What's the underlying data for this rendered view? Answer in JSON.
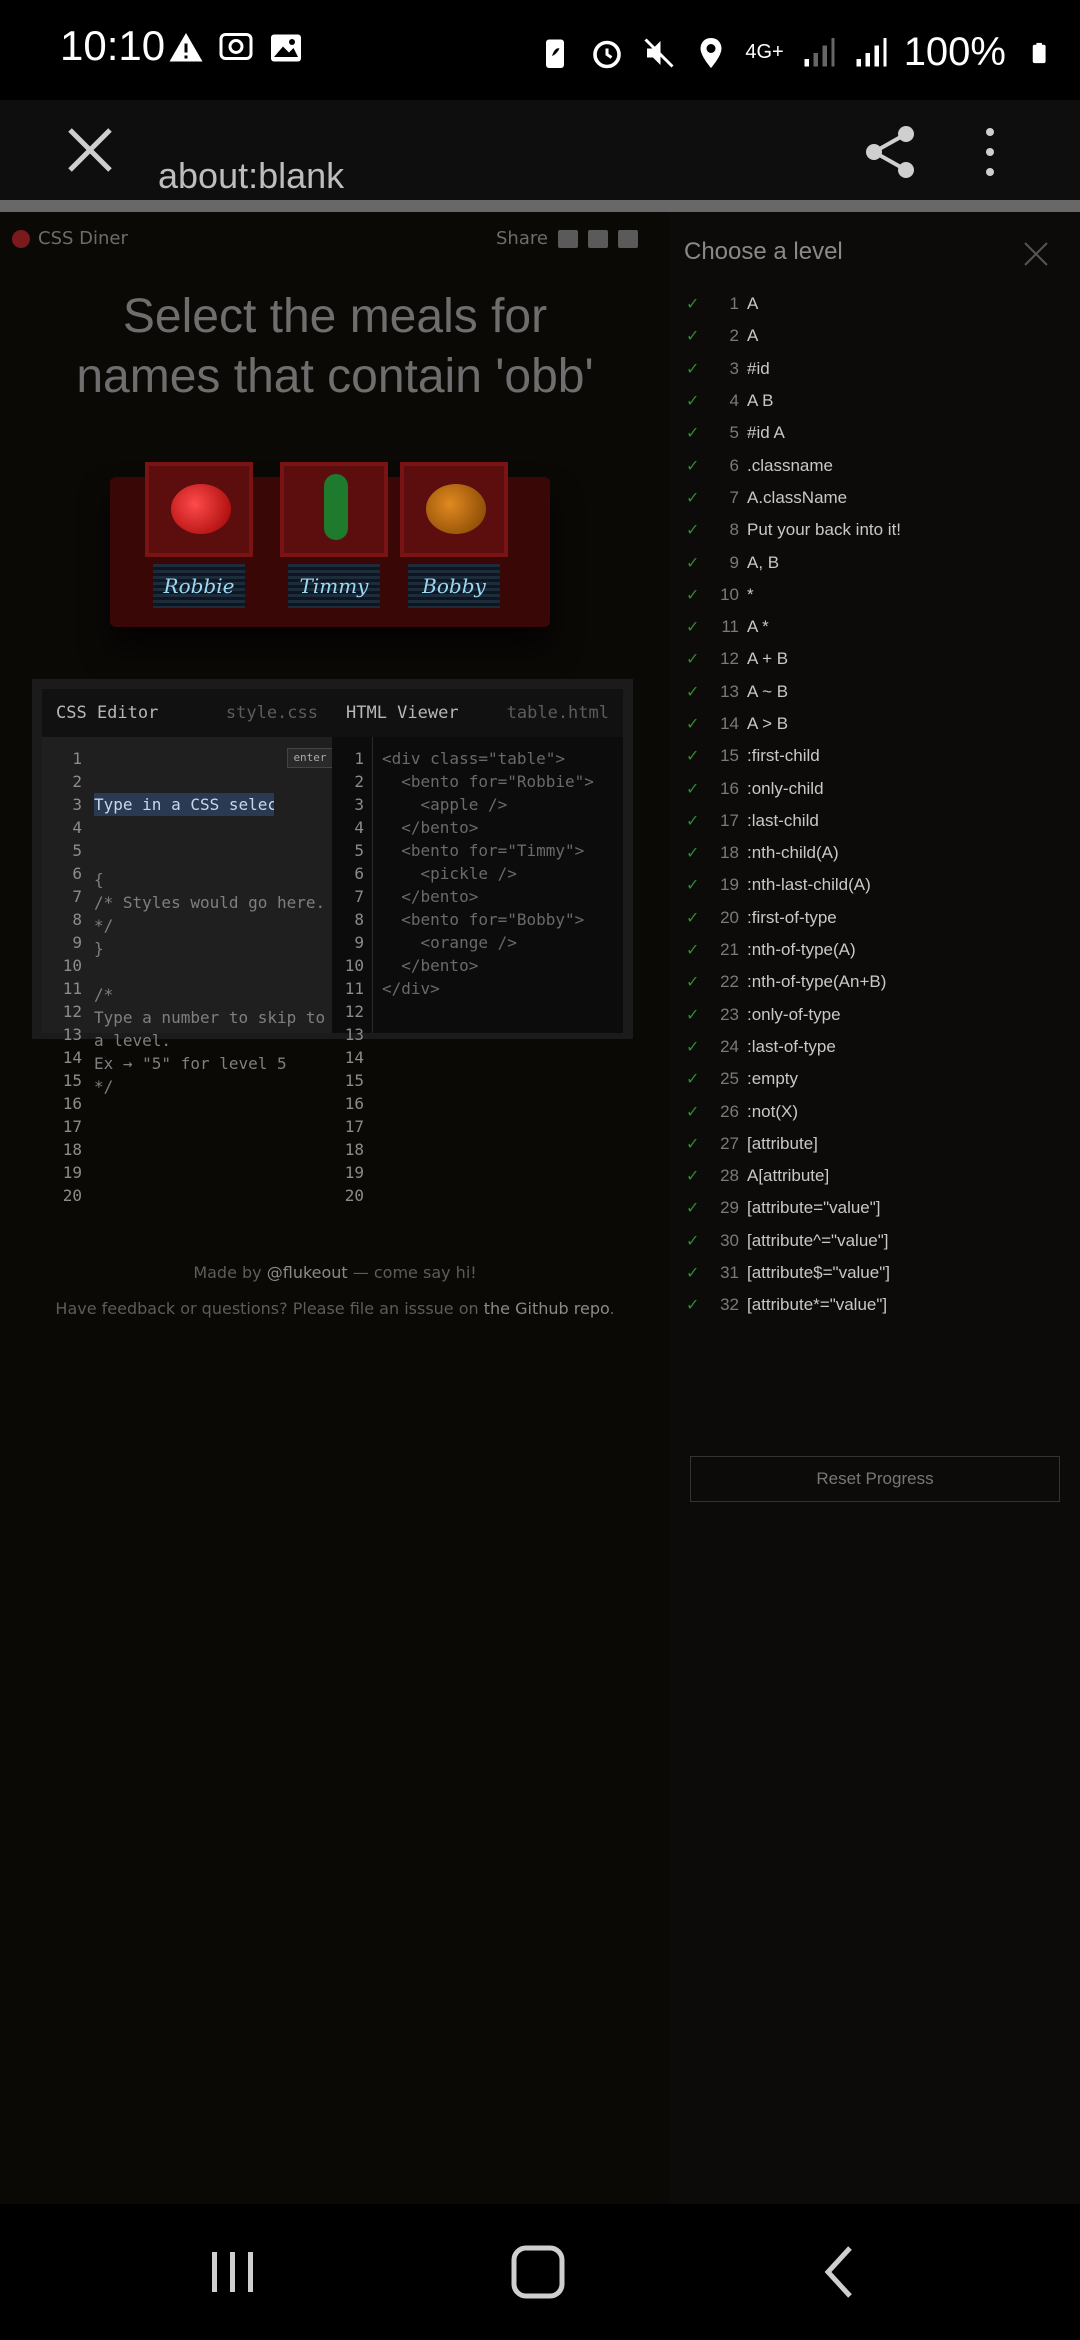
{
  "status_bar": {
    "time": "10:10",
    "battery": "100%",
    "network": "4G+"
  },
  "toolbar": {
    "url": "about:blank"
  },
  "page": {
    "brand": "CSS Diner",
    "share_label": "Share",
    "instruction_line1": "Select the meals for",
    "instruction_line2": "names that contain 'obb'",
    "bentos": [
      {
        "name": "Robbie",
        "food": "apple"
      },
      {
        "name": "Timmy",
        "food": "pickle"
      },
      {
        "name": "Bobby",
        "food": "orange"
      }
    ],
    "css_editor": {
      "title": "CSS Editor",
      "file": "style.css",
      "enter_label": "enter",
      "input_placeholder": "Type in a CSS selector",
      "lines": [
        "{",
        "/* Styles would go here.",
        "*/",
        "}",
        "",
        "/*",
        "Type a number to skip to",
        "a level.",
        "Ex → \"5\" for level 5",
        "*/"
      ]
    },
    "html_viewer": {
      "title": "HTML Viewer",
      "file": "table.html",
      "lines": [
        "<div class=\"table\">",
        "  <bento for=\"Robbie\">",
        "    <apple />",
        "  </bento>",
        "  <bento for=\"Timmy\">",
        "    <pickle />",
        "  </bento>",
        "  <bento for=\"Bobby\">",
        "    <orange />",
        "  </bento>",
        "</div>"
      ]
    },
    "line_numbers": [
      "1",
      "2",
      "3",
      "4",
      "5",
      "6",
      "7",
      "8",
      "9",
      "10",
      "11",
      "12",
      "13",
      "14",
      "15",
      "16",
      "17",
      "18",
      "19",
      "20"
    ],
    "footer_made_by": "Made by",
    "footer_author": "@flukeout",
    "footer_say_hi": "— come say hi!",
    "footer_feedback": "Have feedback or questions? Please file an isssue on",
    "footer_repo": "the Github repo",
    "footer_period": "."
  },
  "levels_panel": {
    "title": "Choose a level",
    "reset_label": "Reset Progress",
    "levels": [
      {
        "num": "1",
        "name": "A"
      },
      {
        "num": "2",
        "name": "A"
      },
      {
        "num": "3",
        "name": "#id"
      },
      {
        "num": "4",
        "name": "A B"
      },
      {
        "num": "5",
        "name": "#id A"
      },
      {
        "num": "6",
        "name": ".classname"
      },
      {
        "num": "7",
        "name": "A.className"
      },
      {
        "num": "8",
        "name": "Put your back into it!"
      },
      {
        "num": "9",
        "name": "A, B"
      },
      {
        "num": "10",
        "name": "*"
      },
      {
        "num": "11",
        "name": "A *"
      },
      {
        "num": "12",
        "name": "A + B"
      },
      {
        "num": "13",
        "name": "A ~ B"
      },
      {
        "num": "14",
        "name": "A > B"
      },
      {
        "num": "15",
        "name": ":first-child"
      },
      {
        "num": "16",
        "name": ":only-child"
      },
      {
        "num": "17",
        "name": ":last-child"
      },
      {
        "num": "18",
        "name": ":nth-child(A)"
      },
      {
        "num": "19",
        "name": ":nth-last-child(A)"
      },
      {
        "num": "20",
        "name": ":first-of-type"
      },
      {
        "num": "21",
        "name": ":nth-of-type(A)"
      },
      {
        "num": "22",
        "name": ":nth-of-type(An+B)"
      },
      {
        "num": "23",
        "name": ":only-of-type"
      },
      {
        "num": "24",
        "name": ":last-of-type"
      },
      {
        "num": "25",
        "name": ":empty"
      },
      {
        "num": "26",
        "name": ":not(X)"
      },
      {
        "num": "27",
        "name": "[attribute]"
      },
      {
        "num": "28",
        "name": "A[attribute]"
      },
      {
        "num": "29",
        "name": "[attribute=\"value\"]"
      },
      {
        "num": "30",
        "name": "[attribute^=\"value\"]"
      },
      {
        "num": "31",
        "name": "[attribute$=\"value\"]"
      },
      {
        "num": "32",
        "name": "[attribute*=\"value\"]"
      }
    ]
  }
}
